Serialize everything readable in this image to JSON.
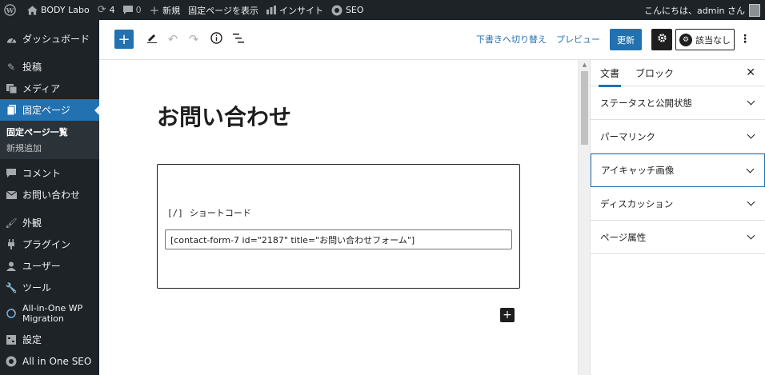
{
  "admin_bar": {
    "site_name": "BODY Labo",
    "updates_count": "4",
    "comments_count": "0",
    "new_label": "新規",
    "view_page_label": "固定ページを表示",
    "insights_label": "インサイト",
    "seo_label": "SEO",
    "greeting": "こんにちは、admin さん"
  },
  "sidebar": {
    "dashboard": "ダッシュボード",
    "posts": "投稿",
    "media": "メディア",
    "pages": "固定ページ",
    "pages_sub": [
      "固定ページ一覧",
      "新規追加"
    ],
    "comments": "コメント",
    "contact": "お問い合わせ",
    "appearance": "外観",
    "plugins": "プラグイン",
    "users": "ユーザー",
    "tools": "ツール",
    "migration_line1": "All-in-One WP",
    "migration_line2": "Migration",
    "settings": "設定",
    "aioseo": "All in One SEO"
  },
  "header": {
    "switch_to_draft": "下書きへ切り替え",
    "preview": "プレビュー",
    "update": "更新",
    "plugin_label": "該当なし"
  },
  "content": {
    "page_title": "お問い合わせ",
    "block_icon": "[/]",
    "block_label": "ショートコード",
    "shortcode_value": "[contact-form-7 id=\"2187\" title=\"お問い合わせフォーム\"]"
  },
  "settings_panel": {
    "tabs": [
      "文書",
      "ブロック"
    ],
    "panels": [
      "ステータスと公開状態",
      "パーマリンク",
      "アイキャッチ画像",
      "ディスカッション",
      "ページ属性"
    ]
  },
  "colors": {
    "admin_dark": "#1d2327",
    "accent": "#2271b1"
  }
}
